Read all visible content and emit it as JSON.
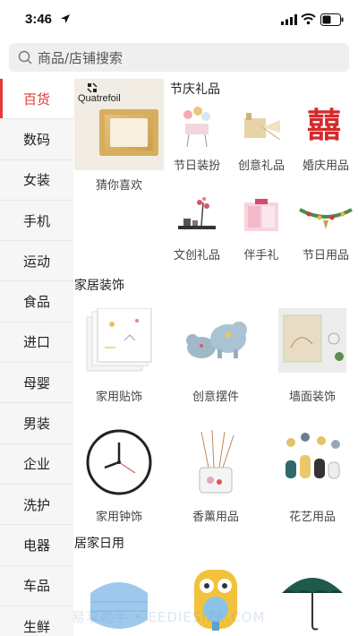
{
  "status": {
    "time": "3:46"
  },
  "search": {
    "placeholder": "商品/店铺搜索"
  },
  "sidebar": {
    "items": [
      {
        "label": "百货"
      },
      {
        "label": "数码"
      },
      {
        "label": "女装"
      },
      {
        "label": "手机"
      },
      {
        "label": "运动"
      },
      {
        "label": "食品"
      },
      {
        "label": "进口"
      },
      {
        "label": "母婴"
      },
      {
        "label": "男装"
      },
      {
        "label": "企业"
      },
      {
        "label": "洗护"
      },
      {
        "label": "电器"
      },
      {
        "label": "车品"
      },
      {
        "label": "生鲜"
      }
    ]
  },
  "banner": {
    "brand": "Quatrefoil",
    "label": "猜你喜欢"
  },
  "sections": {
    "festival": {
      "title": "节庆礼品",
      "items": [
        {
          "label": "节日装扮"
        },
        {
          "label": "创意礼品"
        },
        {
          "label": "婚庆用品"
        },
        {
          "label": "文创礼品"
        },
        {
          "label": "伴手礼"
        },
        {
          "label": "节日用品"
        }
      ]
    },
    "home_decor": {
      "title": "家居装饰",
      "items": [
        {
          "label": "家用贴饰"
        },
        {
          "label": "创意摆件"
        },
        {
          "label": "墙面装饰"
        },
        {
          "label": "家用钟饰"
        },
        {
          "label": "香薰用品"
        },
        {
          "label": "花艺用品"
        }
      ]
    },
    "home_daily": {
      "title": "居家日用"
    }
  },
  "decor": {
    "double_happiness": "囍"
  },
  "watermark": "易享助手 • EEDIESIZE.COM",
  "colors": {
    "accent": "#e53935",
    "sidebar_bg": "#f6f6f6",
    "search_bg": "#efefef"
  }
}
